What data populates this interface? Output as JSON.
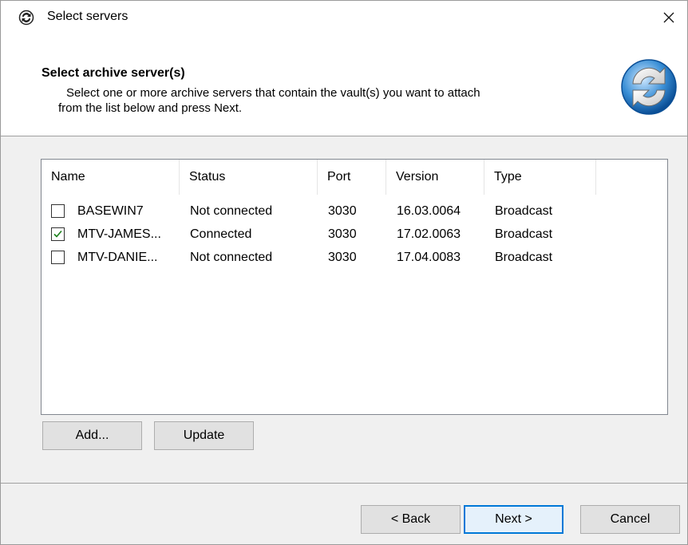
{
  "window": {
    "title": "Select servers",
    "close_glyph": "✕"
  },
  "header": {
    "title": "Select archive server(s)",
    "description_line1": "Select one or more archive servers that contain the vault(s) you want to attach",
    "description_line2": "from the list below and press Next."
  },
  "list": {
    "columns": [
      "Name",
      "Status",
      "Port",
      "Version",
      "Type"
    ],
    "rows": [
      {
        "checked": false,
        "name": "BASEWIN7",
        "status": "Not connected",
        "port": "3030",
        "version": "16.03.0064",
        "type": "Broadcast"
      },
      {
        "checked": true,
        "name": "MTV-JAMES...",
        "status": "Connected",
        "port": "3030",
        "version": "17.02.0063",
        "type": "Broadcast"
      },
      {
        "checked": false,
        "name": "MTV-DANIE...",
        "status": "Not connected",
        "port": "3030",
        "version": "17.04.0083",
        "type": "Broadcast"
      }
    ]
  },
  "actions": {
    "add_label": "Add...",
    "update_label": "Update"
  },
  "footer": {
    "back_label": "< Back",
    "next_label": "Next >",
    "cancel_label": "Cancel"
  },
  "colors": {
    "accent": "#0078d7",
    "check": "#1a7f1a"
  }
}
